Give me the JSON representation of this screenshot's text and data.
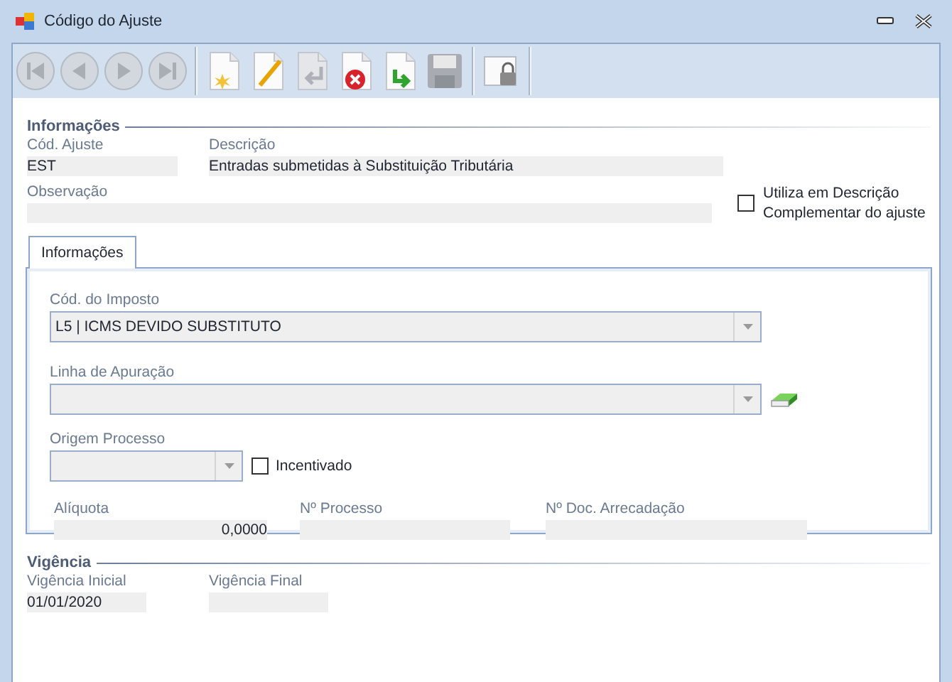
{
  "window": {
    "title": "Código do Ajuste"
  },
  "toolbar": [
    {
      "kind": "first",
      "disabled": true
    },
    {
      "kind": "prev",
      "disabled": true
    },
    {
      "kind": "next",
      "disabled": true
    },
    {
      "kind": "last",
      "disabled": true
    },
    {
      "kind": "sep"
    },
    {
      "kind": "new",
      "disabled": false
    },
    {
      "kind": "edit",
      "disabled": false
    },
    {
      "kind": "undo",
      "disabled": true
    },
    {
      "kind": "delete",
      "disabled": false
    },
    {
      "kind": "confirm",
      "disabled": false
    },
    {
      "kind": "save",
      "disabled": true
    },
    {
      "kind": "sep"
    },
    {
      "kind": "lock",
      "disabled": false
    },
    {
      "kind": "sep"
    }
  ],
  "info": {
    "heading": "Informações",
    "cod_ajuste": {
      "label": "Cód. Ajuste",
      "value": "EST"
    },
    "descricao": {
      "label": "Descrição",
      "value": "Entradas submetidas à Substituição Tributária"
    },
    "observacao": {
      "label": "Observação"
    },
    "complementar": {
      "label": "Utiliza em Descrição Complementar do ajuste",
      "checked": false
    }
  },
  "tabs": [
    {
      "label": "Informações",
      "selected": true
    }
  ],
  "tab_panel": {
    "cod_imposto": {
      "label": "Cód. do Imposto",
      "value": "L5 | ICMS DEVIDO SUBSTITUTO"
    },
    "linha_apuracao": {
      "label": "Linha de Apuração"
    },
    "origem_processo": {
      "label": "Origem Processo"
    },
    "incentivado": {
      "label": "Incentivado",
      "checked": false
    },
    "aliquota": {
      "label": "Alíquota",
      "value": "0,0000"
    },
    "n_processo": {
      "label": "Nº Processo"
    },
    "n_doc": {
      "label": "Nº Doc. Arrecadação"
    }
  },
  "vigencia": {
    "heading": "Vigência",
    "inicial": {
      "label": "Vigência Inicial",
      "value": "01/01/2020"
    },
    "final": {
      "label": "Vigência Final"
    }
  }
}
